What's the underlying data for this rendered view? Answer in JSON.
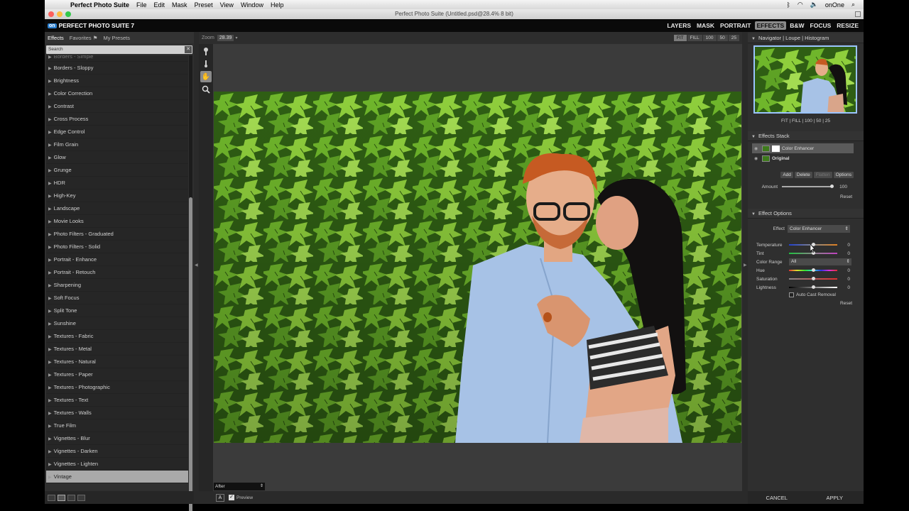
{
  "os_menu": {
    "app_name": "Perfect Photo Suite",
    "items": [
      "File",
      "Edit",
      "Mask",
      "Preset",
      "View",
      "Window",
      "Help"
    ],
    "status_user": "onOne"
  },
  "window": {
    "title": "Perfect Photo Suite (Untitled.psd@28.4% 8 bit)"
  },
  "app": {
    "logo_mark": "on",
    "name": "PERFECT PHOTO SUITE 7",
    "modules": [
      "LAYERS",
      "MASK",
      "PORTRAIT",
      "EFFECTS",
      "B&W",
      "FOCUS",
      "RESIZE"
    ],
    "active_module": "EFFECTS"
  },
  "left_panel": {
    "tabs": [
      "Effects",
      "Favorites",
      "My Presets"
    ],
    "favorites_flag": "⚑",
    "search_placeholder": "Search",
    "categories": [
      "Borders - Simple",
      "Borders - Sloppy",
      "Brightness",
      "Color Correction",
      "Contrast",
      "Cross Process",
      "Edge Control",
      "Film Grain",
      "Glow",
      "Grunge",
      "HDR",
      "High-Key",
      "Landscape",
      "Movie Looks",
      "Photo Filters - Graduated",
      "Photo Filters - Solid",
      "Portrait - Enhance",
      "Portrait - Retouch",
      "Sharpening",
      "Soft Focus",
      "Split Tone",
      "Sunshine",
      "Textures - Fabric",
      "Textures - Metal",
      "Textures - Natural",
      "Textures - Paper",
      "Textures - Photographic",
      "Textures - Text",
      "Textures - Walls",
      "True Film",
      "Vignettes - Blur",
      "Vignettes - Darken",
      "Vignettes - Lighten",
      "Vintage"
    ],
    "selected_category": "Vintage"
  },
  "toolbar": {
    "zoom_label": "Zoom",
    "zoom_value": "28.39",
    "zoom_buttons": [
      "FIT",
      "FILL",
      "100",
      "50",
      "25"
    ],
    "active_zoom": "FIT"
  },
  "canvas": {
    "view_mode": "After",
    "a_button": "A",
    "preview_label": "Preview",
    "preview_checked": true
  },
  "navigator": {
    "tabs_text": "Navigator | Loupe | Histogram",
    "zoom_text": "FIT | FILL | 100 | 50 | 25"
  },
  "effects_stack": {
    "title": "Effects Stack",
    "layers": [
      {
        "name": "Color Enhancer",
        "selected": true
      },
      {
        "name": "Original",
        "selected": false
      }
    ],
    "buttons": [
      "Add",
      "Delete",
      "Flatten",
      "Options"
    ],
    "amount_label": "Amount",
    "amount_value": "100",
    "reset": "Reset"
  },
  "effect_options": {
    "title": "Effect Options",
    "effect_label": "Effect",
    "effect_value": "Color Enhancer",
    "temperature_label": "Temperature",
    "temperature_value": "0",
    "tint_label": "Tint",
    "tint_value": "0",
    "color_range_label": "Color Range",
    "color_range_value": "All",
    "hue_label": "Hue",
    "hue_value": "0",
    "saturation_label": "Saturation",
    "saturation_value": "0",
    "lightness_label": "Lightness",
    "lightness_value": "0",
    "auto_cast_label": "Auto Cast Removal",
    "reset": "Reset"
  },
  "footer": {
    "cancel": "CANCEL",
    "apply": "APPLY"
  },
  "colors": {
    "accent_blue": "#2a7fd0",
    "panel_bg": "#2f2f2f",
    "selected_row": "#a9a9a9",
    "leaf_green": "#3b6d1a"
  }
}
